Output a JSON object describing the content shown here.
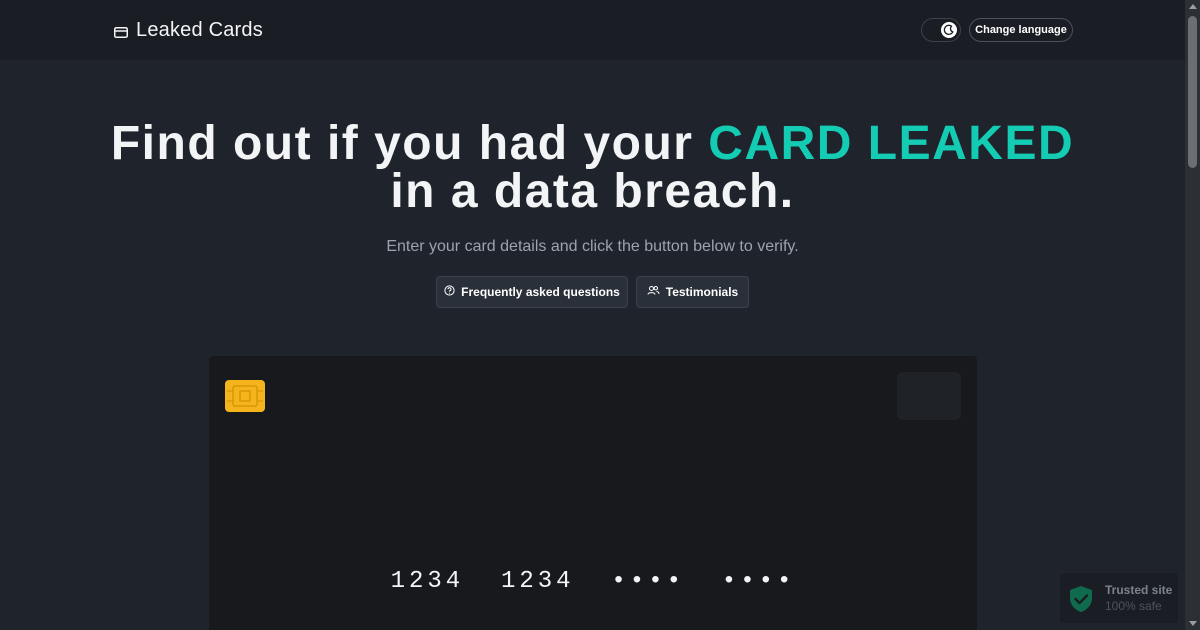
{
  "header": {
    "brand_title": "Leaked Cards",
    "brand_icon": "credit-card-icon",
    "theme_toggle_icon": "moon-icon",
    "language_button": "Change language"
  },
  "hero": {
    "title_prefix": "Find out if you had your",
    "title_accent": "CARD LEAKED",
    "title_suffix": "in a data breach.",
    "subtitle": "Enter your card details and click the button below to verify.",
    "accent_color": "#14ccb4"
  },
  "actions": {
    "faq_label": "Frequently asked questions",
    "faq_icon": "question-circle-icon",
    "testimonials_label": "Testimonials",
    "testimonials_icon": "users-icon"
  },
  "card_preview": {
    "number": "1234  1234  ••••  ••••",
    "chip_icon": "card-chip-icon",
    "chip_color": "#f5b41c"
  },
  "trust_badge": {
    "title": "Trusted site",
    "subtitle": "100% safe",
    "icon": "shield-check-icon"
  }
}
